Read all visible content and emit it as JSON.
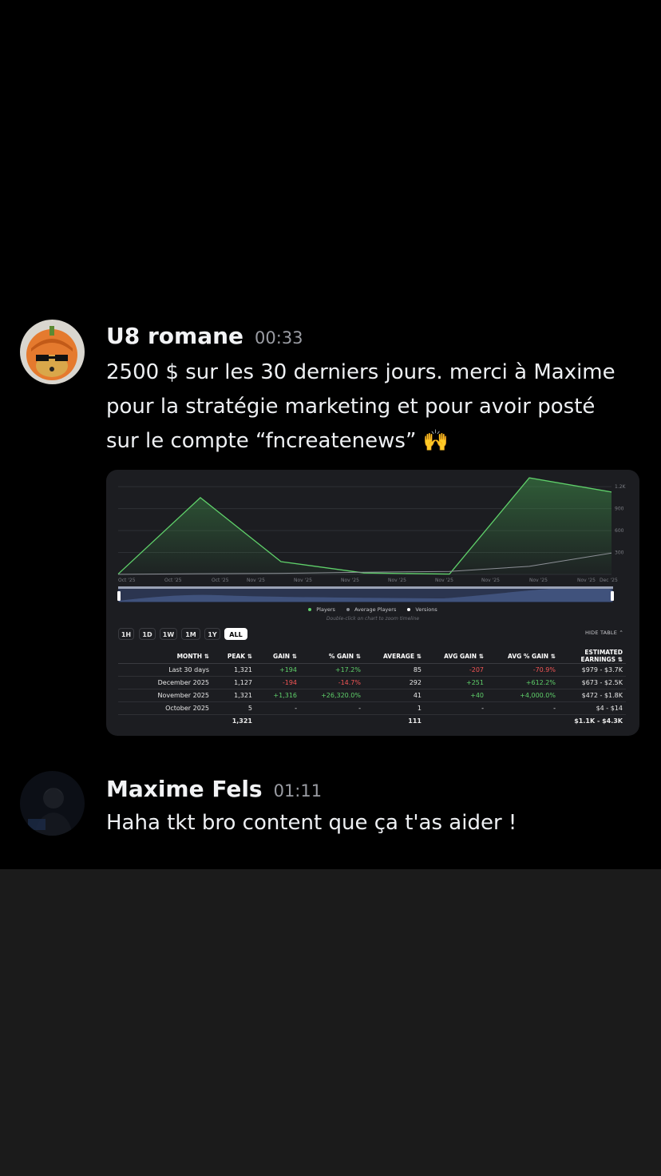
{
  "messages": [
    {
      "author": "U8 romane",
      "time": "00:33",
      "text": "2500 $ sur les 30 derniers jours. merci à Maxime pour la stratégie marketing et pour avoir posté sur le compte “fncreatenews” 🙌"
    },
    {
      "author": "Maxime Fels",
      "time": "01:11",
      "text": "Haha tkt bro content que ça t'as aider !"
    }
  ],
  "embed": {
    "legend": [
      "Players",
      "Average Players",
      "Versions"
    ],
    "hint": "Double-click on chart to zoom timeline",
    "ranges": [
      "1H",
      "1D",
      "1W",
      "1M",
      "1Y",
      "ALL"
    ],
    "active_range": "ALL",
    "hide_table": "HIDE TABLE",
    "colors": {
      "players": "#5fd06a",
      "avg": "#8c8f96",
      "positive": "#5fd06a",
      "negative": "#f25555"
    },
    "table": {
      "headers": [
        "MONTH",
        "PEAK",
        "GAIN",
        "% GAIN",
        "AVERAGE",
        "AVG GAIN",
        "AVG % GAIN",
        "ESTIMATED EARNINGS"
      ],
      "rows": [
        [
          "Last 30 days",
          "1,321",
          "+194",
          "+17.2%",
          "85",
          "-207",
          "-70.9%",
          "$979 - $3.7K"
        ],
        [
          "December 2025",
          "1,127",
          "-194",
          "-14.7%",
          "292",
          "+251",
          "+612.2%",
          "$673 - $2.5K"
        ],
        [
          "November 2025",
          "1,321",
          "+1,316",
          "+26,320.0%",
          "41",
          "+40",
          "+4,000.0%",
          "$472 - $1.8K"
        ],
        [
          "October 2025",
          "5",
          "-",
          "-",
          "1",
          "-",
          "-",
          "$4 - $14"
        ]
      ],
      "total": [
        "",
        "1,321",
        "",
        "",
        "111",
        "",
        "",
        "$1.1K - $4.3K"
      ]
    }
  },
  "chart_data": {
    "type": "area",
    "x": [
      "Oct '25",
      "Oct '25",
      "Oct '25",
      "Nov '25",
      "Nov '25",
      "Nov '25",
      "Nov '25",
      "Nov '25",
      "Nov '25",
      "Nov '25",
      "Nov '25",
      "Dec '25"
    ],
    "series": [
      {
        "name": "Players",
        "values": [
          5,
          1050,
          175,
          20,
          5,
          1321,
          1127
        ]
      },
      {
        "name": "Average Players",
        "values": [
          1,
          10,
          15,
          30,
          41,
          111,
          292
        ]
      }
    ],
    "y_ticks": [
      "300",
      "600",
      "900",
      "1.2K"
    ],
    "ylim": [
      0,
      1300
    ],
    "grid": true
  }
}
